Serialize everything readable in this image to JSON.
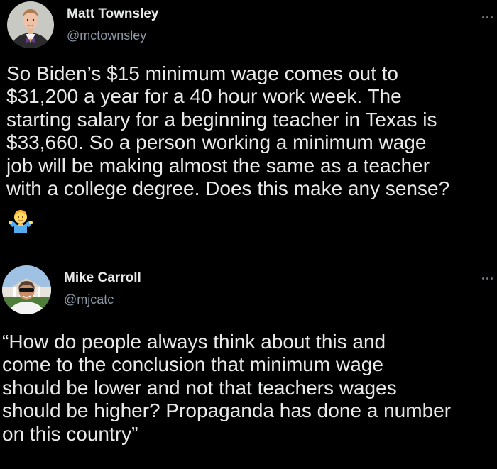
{
  "tweets": [
    {
      "author": {
        "display_name": "Matt Townsley",
        "handle": "@mctownsley"
      },
      "text": "So Biden’s $15 minimum wage comes out to\n$31,200 a year for a 40 hour work week. The\nstarting salary for a beginning teacher in Texas is\n$33,660. So a person working a minimum wage\njob will be making almost the same as a teacher\nwith a college degree. Does this make any sense?",
      "emoji": "person-shrugging-icon"
    },
    {
      "author": {
        "display_name": "Mike Carroll",
        "handle": "@mjcatc"
      },
      "text": "“How do people always think about this and\ncome to the conclusion that minimum wage\nshould be lower and not that teachers wages\nshould be higher? Propaganda has done a number\non this country”"
    }
  ],
  "colors": {
    "background": "#000000",
    "primary_text": "#e7e9ea",
    "secondary_text": "#8b98a5",
    "icon": "#6e767d"
  }
}
